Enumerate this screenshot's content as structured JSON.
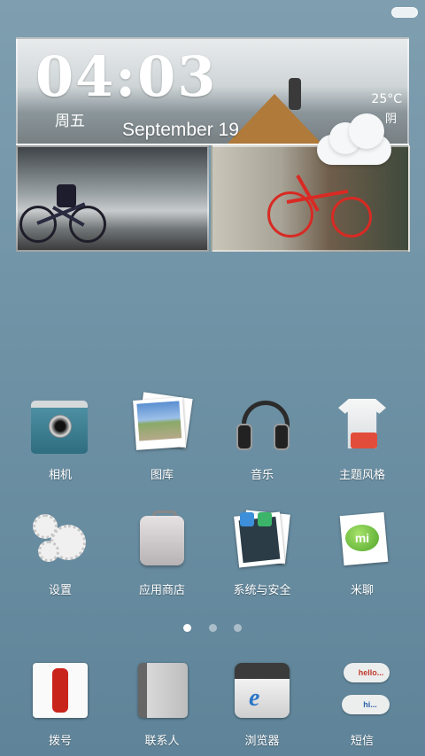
{
  "widget": {
    "time": "04:03",
    "weekday": "周五",
    "date": "September 19",
    "temperature": "25°C",
    "condition": "阴",
    "weather_icon": "cloud-icon"
  },
  "apps_row1": [
    {
      "label": "相机",
      "icon": "camera-icon"
    },
    {
      "label": "图库",
      "icon": "gallery-icon"
    },
    {
      "label": "音乐",
      "icon": "headphones-icon"
    },
    {
      "label": "主题风格",
      "icon": "tshirt-icon"
    }
  ],
  "apps_row2": [
    {
      "label": "设置",
      "icon": "gears-icon"
    },
    {
      "label": "应用商店",
      "icon": "suitcase-icon"
    },
    {
      "label": "系统与安全",
      "icon": "security-icon"
    },
    {
      "label": "米聊",
      "icon": "miliao-icon"
    }
  ],
  "dock": [
    {
      "label": "拨号",
      "icon": "phone-icon"
    },
    {
      "label": "联系人",
      "icon": "contacts-icon"
    },
    {
      "label": "浏览器",
      "icon": "browser-icon"
    },
    {
      "label": "短信",
      "icon": "sms-icon"
    }
  ],
  "page_indicator": {
    "count": 3,
    "active": 1
  },
  "icon_text": {
    "miliao": "mi",
    "browser": "e",
    "sms_top": "hello...",
    "sms_bottom": "hi..."
  }
}
